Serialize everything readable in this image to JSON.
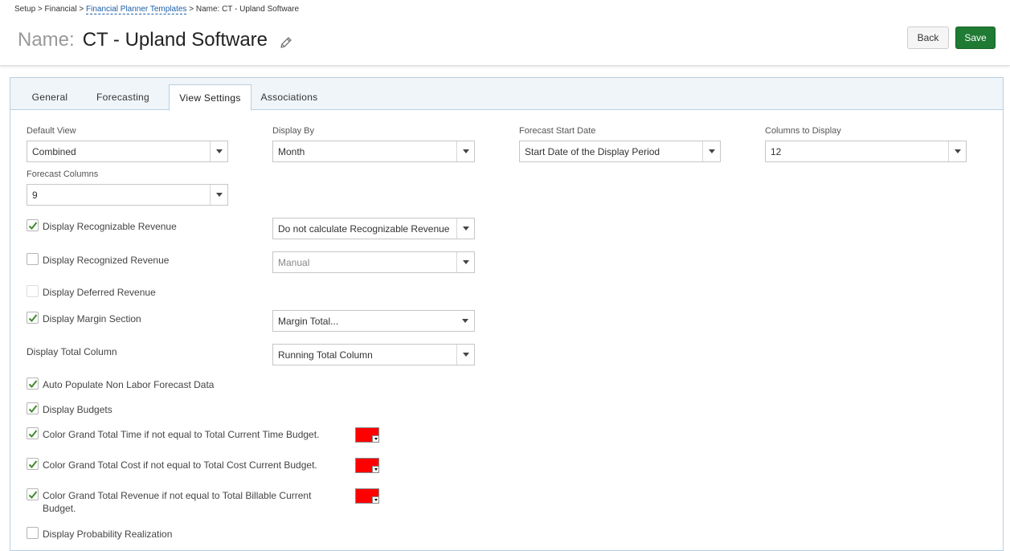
{
  "breadcrumb": {
    "setup": "Setup",
    "sep1": " > ",
    "financial": "Financial",
    "sep2": " > ",
    "templates": "Financial Planner Templates",
    "sep3": " > ",
    "current": "Name: CT - Upland Software"
  },
  "header": {
    "name_label": "Name:",
    "name_value": "CT - Upland Software",
    "back_label": "Back",
    "save_label": "Save"
  },
  "tabs": [
    {
      "label": "General"
    },
    {
      "label": "Forecasting"
    },
    {
      "label": "View Settings"
    },
    {
      "label": "Associations"
    }
  ],
  "active_tab": "View Settings",
  "fields": {
    "default_view": {
      "label": "Default View",
      "value": "Combined"
    },
    "display_by": {
      "label": "Display By",
      "value": "Month"
    },
    "forecast_start_date": {
      "label": "Forecast Start Date",
      "value": "Start Date of the Display Period"
    },
    "columns_to_display": {
      "label": "Columns to Display",
      "value": "12"
    },
    "forecast_columns": {
      "label": "Forecast Columns",
      "value": "9"
    }
  },
  "options": {
    "recognizable_revenue": {
      "label": "Display Recognizable Revenue",
      "checked": true,
      "select": "Do not calculate Recognizable Revenue"
    },
    "recognized_revenue": {
      "label": "Display Recognized Revenue",
      "checked": false,
      "select": "Manual"
    },
    "deferred_revenue": {
      "label": "Display Deferred Revenue",
      "checked": false,
      "disabled": true
    },
    "margin_section": {
      "label": "Display Margin Section",
      "checked": true,
      "select": "Margin Total..."
    },
    "total_column": {
      "label": "Display Total Column",
      "select": "Running Total Column"
    },
    "auto_populate": {
      "label": "Auto Populate Non Labor Forecast Data",
      "checked": true
    },
    "display_budgets": {
      "label": "Display Budgets",
      "checked": true
    },
    "color_time": {
      "label": "Color Grand Total Time if not equal to Total Current Time Budget.",
      "checked": true,
      "color": "#ff0000"
    },
    "color_cost": {
      "label": "Color Grand Total Cost if not equal to Total Cost Current Budget.",
      "checked": true,
      "color": "#ff0000"
    },
    "color_revenue": {
      "label_line1": "Color Grand Total Revenue if not equal to Total Billable Current",
      "label_line2": "Budget.",
      "checked": true,
      "color": "#ff0000"
    },
    "probability": {
      "label": "Display Probability Realization",
      "checked": false
    }
  },
  "colors": {
    "save_button": "#1f7a33",
    "link": "#1a5ea8",
    "checkmark": "#3f8a2a",
    "tabbar": "#f0f5f9"
  }
}
